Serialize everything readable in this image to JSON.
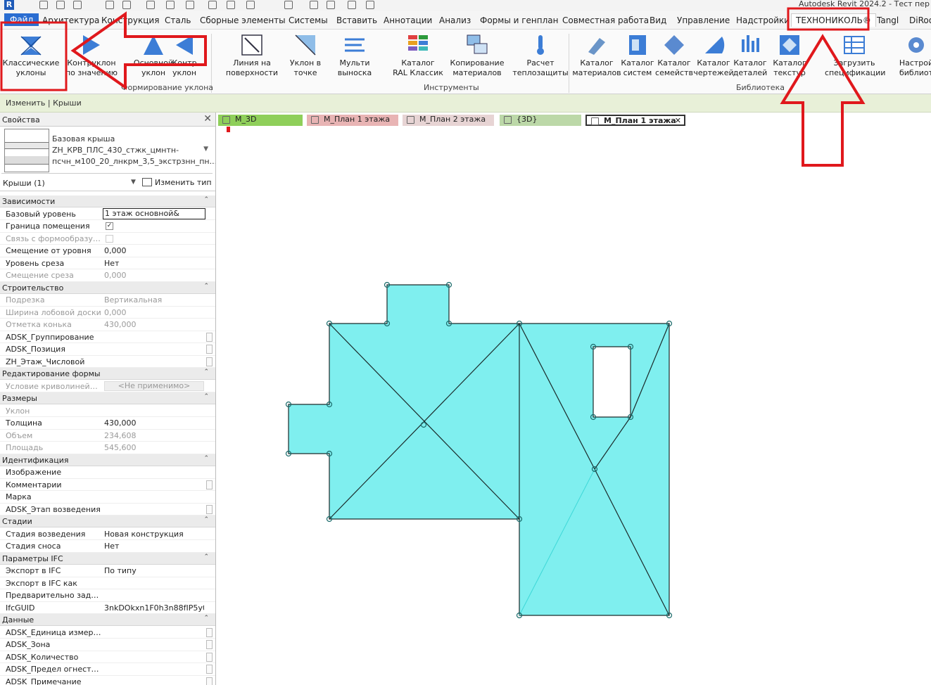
{
  "app": {
    "title": "Autodesk Revit 2024.2 - Тест пер",
    "logo_letter": "R"
  },
  "ribbon_tabs": {
    "file": "Файл",
    "items": [
      "Архитектура",
      "Конструкция",
      "Сталь",
      "Сборные элементы",
      "Системы",
      "Вставить",
      "Аннотации",
      "Анализ",
      "Формы и генплан",
      "Совместная работа",
      "Вид",
      "Управление",
      "Надстройки"
    ],
    "active": "ТЕХНОНИКОЛЬ®",
    "after": [
      "Tangl",
      "DiRoo"
    ]
  },
  "tools": [
    {
      "label": "Классические\nуклоны",
      "icon": "classic-slope-icon"
    },
    {
      "label": "Контруклон\nпо значению",
      "icon": "counter-slope-value-icon"
    },
    {
      "label": "Основной\nуклон",
      "icon": "main-slope-icon"
    },
    {
      "label": "Контр\nуклон",
      "icon": "counter-slope-icon"
    },
    {
      "label": "Линия на\nповерхности",
      "icon": "surface-line-icon"
    },
    {
      "label": "Уклон в\nточке",
      "icon": "point-slope-icon"
    },
    {
      "label": "Мульти\nвыноска",
      "icon": "multi-leader-icon"
    },
    {
      "label": "Каталог\nRAL Классик",
      "icon": "ral-catalog-icon"
    },
    {
      "label": "Копирование\nматериалов",
      "icon": "copy-materials-icon"
    },
    {
      "label": "Расчет\nтеплозащиты",
      "icon": "thermal-calc-icon"
    },
    {
      "label": "Каталог\nматериалов",
      "icon": "materials-catalog-icon"
    },
    {
      "label": "Каталог\nсистем",
      "icon": "systems-catalog-icon"
    },
    {
      "label": "Каталог\nсемейств",
      "icon": "families-catalog-icon"
    },
    {
      "label": "Каталог\nчертежей",
      "icon": "drawings-catalog-icon"
    },
    {
      "label": "Каталог\nдеталей",
      "icon": "details-catalog-icon"
    },
    {
      "label": "Каталог\nтекстур",
      "icon": "textures-catalog-icon"
    },
    {
      "label": "Загрузить\nспецификации",
      "icon": "load-schedules-icon"
    },
    {
      "label": "Настрой\nбиблиот",
      "icon": "library-settings-icon"
    }
  ],
  "panels": {
    "slope": "Формирование уклона",
    "tools": "Инструменты",
    "library": "Библиотека"
  },
  "context_bar": "Изменить | Крыши",
  "properties": {
    "title": "Свойства",
    "type_name": "Базовая крыша\nZH_КРВ_ПЛС_430_стжк_цмнтн-\nпсчн_м100_20_лнкрм_3,5_экстрзнн_пн...",
    "instance_count": "Крыши (1)",
    "edit_type": "Изменить тип",
    "groups": [
      {
        "name": "Зависимости",
        "rows": [
          {
            "k": "Базовый уровень",
            "v": "1 этаж основной&",
            "box": true
          },
          {
            "k": "Граница помещения",
            "check": true
          },
          {
            "k": "Связь с формообразую...",
            "check": false,
            "dis": true
          },
          {
            "k": "Смещение от уровня",
            "v": "0,000"
          },
          {
            "k": "Уровень среза",
            "v": "Нет"
          },
          {
            "k": "Смещение среза",
            "v": "0,000",
            "dis": true
          }
        ]
      },
      {
        "name": "Строительство",
        "rows": [
          {
            "k": "Подрезка",
            "v": "Вертикальная",
            "dis": true
          },
          {
            "k": "Ширина лобовой доски",
            "v": "0,000",
            "dis": true
          },
          {
            "k": "Отметка конька",
            "v": "430,000",
            "dis": true
          },
          {
            "k": "ADSK_Группирование",
            "v": "",
            "sbtn": true
          },
          {
            "k": "ADSK_Позиция",
            "v": "",
            "sbtn": true
          },
          {
            "k": "ZH_Этаж_Числовой",
            "v": "",
            "sbtn": true
          }
        ]
      },
      {
        "name": "Редактирование формы",
        "rows": [
          {
            "k": "Условие криволинейно...",
            "na": "<Не применимо>",
            "dis": true
          }
        ]
      },
      {
        "name": "Размеры",
        "rows": [
          {
            "k": "Уклон",
            "v": "",
            "dis": true
          },
          {
            "k": "Толщина",
            "v": "430,000"
          },
          {
            "k": "Объем",
            "v": "234,608",
            "dis": true
          },
          {
            "k": "Площадь",
            "v": "545,600",
            "dis": true
          }
        ]
      },
      {
        "name": "Идентификация",
        "rows": [
          {
            "k": "Изображение",
            "v": ""
          },
          {
            "k": "Комментарии",
            "v": "",
            "sbtn": true
          },
          {
            "k": "Марка",
            "v": ""
          },
          {
            "k": "ADSK_Этап возведения",
            "v": "",
            "sbtn": true
          }
        ]
      },
      {
        "name": "Стадии",
        "rows": [
          {
            "k": "Стадия возведения",
            "v": "Новая конструкция"
          },
          {
            "k": "Стадия сноса",
            "v": "Нет"
          }
        ]
      },
      {
        "name": "Параметры IFC",
        "rows": [
          {
            "k": "Экспорт в IFC",
            "v": "По типу"
          },
          {
            "k": "Экспорт в IFC как",
            "v": ""
          },
          {
            "k": "Предварительно задан...",
            "v": ""
          },
          {
            "k": "IfcGUID",
            "v": "3nkDOkxn1F0h3n88fIP5y0"
          }
        ]
      },
      {
        "name": "Данные",
        "rows": [
          {
            "k": "ADSK_Единица измерен...",
            "v": "",
            "sbtn": true
          },
          {
            "k": "ADSK_Зона",
            "v": "",
            "sbtn": true
          },
          {
            "k": "ADSK_Количество",
            "v": "",
            "sbtn": true
          },
          {
            "k": "ADSK_Предел огнестой...",
            "v": "",
            "sbtn": true
          },
          {
            "k": "ADSK_Примечание",
            "v": "",
            "sbtn": true
          }
        ]
      }
    ]
  },
  "view_tabs": [
    {
      "label": "M_3D",
      "color": "#8fcf5a"
    },
    {
      "label": "M_План 1 этажа",
      "color": "#e8b4b4"
    },
    {
      "label": "M_План 2 этажа",
      "color": "#e7d4d4"
    },
    {
      "label": "{3D}",
      "color": "#bcd8a8"
    },
    {
      "label": "M_План 1 этажа",
      "color": "#ffffff",
      "active": true
    }
  ],
  "colors": {
    "roof_fill": "#7fefef",
    "highlight_red": "#e0181c",
    "accent_blue": "#2a6dd1"
  }
}
